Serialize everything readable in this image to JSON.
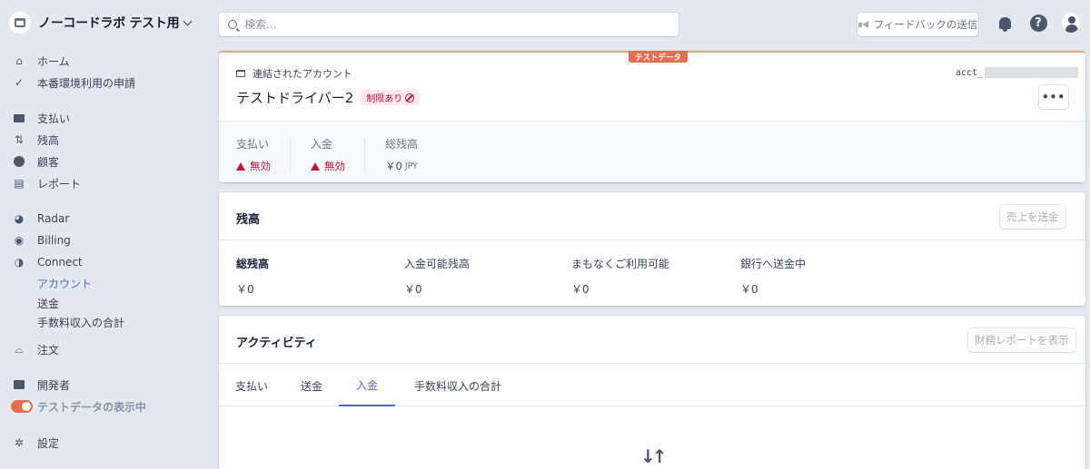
{
  "account": {
    "name": "ノーコードラボ テスト用"
  },
  "sidebar": {
    "home": "ホーム",
    "activate": "本番環境利用の申請",
    "payments": "支払い",
    "balances": "残高",
    "customers": "顧客",
    "reports": "レポート",
    "radar": "Radar",
    "billing": "Billing",
    "connect": "Connect",
    "connect_sub": [
      "アカウント",
      "送金",
      "手数料収入の合計"
    ],
    "orders": "注文",
    "developers": "開発者",
    "test_data": "テストデータの表示中",
    "settings": "設定"
  },
  "topbar": {
    "search_placeholder": "検索...",
    "feedback": "フィードバックの送信"
  },
  "account_card": {
    "test_tag": "テストデータ",
    "linked_label": "連結されたアカウント",
    "account_id_prefix": "acct_",
    "title": "テストドライバー2",
    "badge": "制限あり",
    "more": "•••",
    "stats": {
      "payments_label": "支払い",
      "payments_value": "無効",
      "payouts_label": "入金",
      "payouts_value": "無効",
      "total_label": "総残高",
      "total_value": "￥0",
      "total_unit": "JPY"
    }
  },
  "balance_card": {
    "title": "残高",
    "button": "売上を送金",
    "items": [
      {
        "label": "総残高",
        "value": "￥0"
      },
      {
        "label": "入金可能残高",
        "value": "￥0"
      },
      {
        "label": "まもなくご利用可能",
        "value": "￥0"
      },
      {
        "label": "銀行へ送金中",
        "value": "￥0"
      }
    ]
  },
  "activity_card": {
    "title": "アクティビティ",
    "button": "財務レポートを表示",
    "tabs": [
      "支払い",
      "送金",
      "入金",
      "手数料収入の合計"
    ],
    "active_tab": "入金"
  },
  "colors": {
    "accent": "#5469d4",
    "test": "#e56f4a",
    "danger": "#c0123c"
  }
}
